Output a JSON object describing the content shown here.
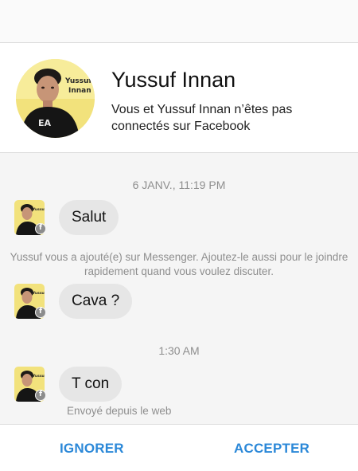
{
  "profile": {
    "name": "Yussuf Innan",
    "subtitle": "Vous et Yussuf Innan n’êtes pas connectés sur Facebook",
    "avatar_caption": "Yussuf\nInnan"
  },
  "conversation": {
    "timestamp_1": "6 JANV., 11:19 PM",
    "message_1": "Salut",
    "system_note": "Yussuf vous a ajouté(e) sur Messenger. Ajoutez-le aussi pour le joindre rapidement quand vous voulez discuter.",
    "message_2": "Cava ?",
    "timestamp_2": "1:30 AM",
    "message_3": "T con",
    "sent_via": "Envoyé depuis le web",
    "badge_glyph": "f"
  },
  "actions": {
    "ignore_label": "IGNORER",
    "accept_label": "ACCEPTER"
  },
  "colors": {
    "accent": "#2b88d8",
    "bubble": "#e6e6e6",
    "muted_text": "#8e8e8e"
  }
}
